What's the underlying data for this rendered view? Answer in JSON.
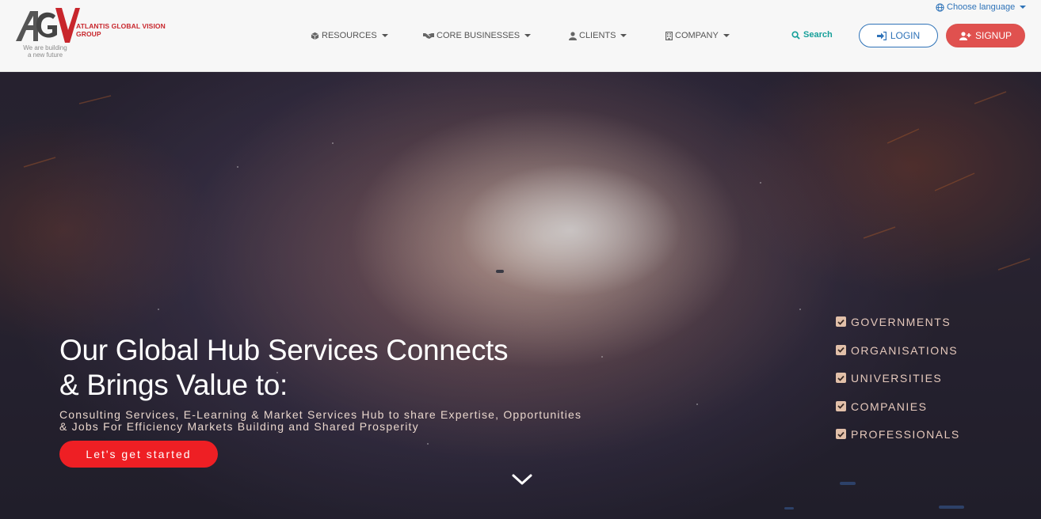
{
  "header": {
    "logo": {
      "monogram": "AGV",
      "name": "ATLANTIS GLOBAL VISION GROUP",
      "tagline_line1": "We are building",
      "tagline_line2": "a new future"
    },
    "language_label": "Choose language",
    "nav": [
      {
        "label": "RESOURCES",
        "icon": "cube-icon"
      },
      {
        "label": "CORE BUSINESSES",
        "icon": "handshake-icon"
      },
      {
        "label": "CLIENTS",
        "icon": "user-icon"
      },
      {
        "label": "COMPANY",
        "icon": "building-icon"
      }
    ],
    "search_label": "Search",
    "login_label": "LOGIN",
    "signup_label": "SIGNUP"
  },
  "hero": {
    "title_line1": "Our Global Hub Services Connects",
    "title_line2": "& Brings Value to:",
    "subtitle_line1": "Consulting Services, E-Learning & Market Services Hub to share Expertise, Opportunities",
    "subtitle_line2": "& Jobs For Efficiency Markets Building and Shared Prosperity",
    "cta_label": "Let's get started",
    "audience": [
      "GOVERNMENTS",
      "ORGANISATIONS",
      "UNIVERSITIES",
      "COMPANIES",
      "PROFESSIONALS"
    ]
  },
  "colors": {
    "brand_red": "#c8262c",
    "link_blue": "#2f73b8",
    "search_teal": "#17a09a",
    "cta_red": "#ee1f24"
  }
}
